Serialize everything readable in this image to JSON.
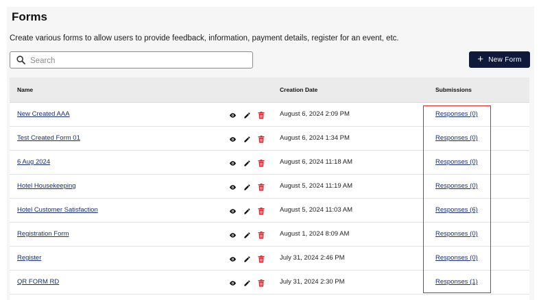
{
  "page": {
    "title": "Forms",
    "subtitle": "Create various forms to allow users to provide feedback, information, payment details, register for an event, etc."
  },
  "search": {
    "placeholder": "Search",
    "value": ""
  },
  "new_form_button": {
    "label": "New Form"
  },
  "table": {
    "columns": [
      "Name",
      "Creation Date",
      "Submissions"
    ],
    "rows": [
      {
        "name": "New Created AAA",
        "created": "August 6, 2024 2:09 PM",
        "submissions": "Responses (0)"
      },
      {
        "name": "Test Created Form 01",
        "created": "August 6, 2024 1:34 PM",
        "submissions": "Responses (0)"
      },
      {
        "name": "6 Aug 2024",
        "created": "August 6, 2024 11:18 AM",
        "submissions": "Responses (0)"
      },
      {
        "name": "Hotel Housekeeping",
        "created": "August 5, 2024 11:19 AM",
        "submissions": "Responses (0)"
      },
      {
        "name": "Hotel Customer Satisfaction",
        "created": "August 5, 2024 11:03 AM",
        "submissions": "Responses (6)"
      },
      {
        "name": "Registration Form",
        "created": "August 1, 2024 8:09 AM",
        "submissions": "Responses (0)"
      },
      {
        "name": "Register",
        "created": "July 31, 2024 2:46 PM",
        "submissions": "Responses (0)"
      },
      {
        "name": "QR FORM RD",
        "created": "July 31, 2024 2:30 PM",
        "submissions": "Responses (1)"
      }
    ],
    "row_icons": [
      "eye-icon",
      "pencil-icon",
      "trash-icon"
    ]
  },
  "colors": {
    "button_bg": "#0f1a3a",
    "link": "#1a2d6b",
    "delete_icon": "#d9252a",
    "highlight_border": "#d9252a"
  }
}
